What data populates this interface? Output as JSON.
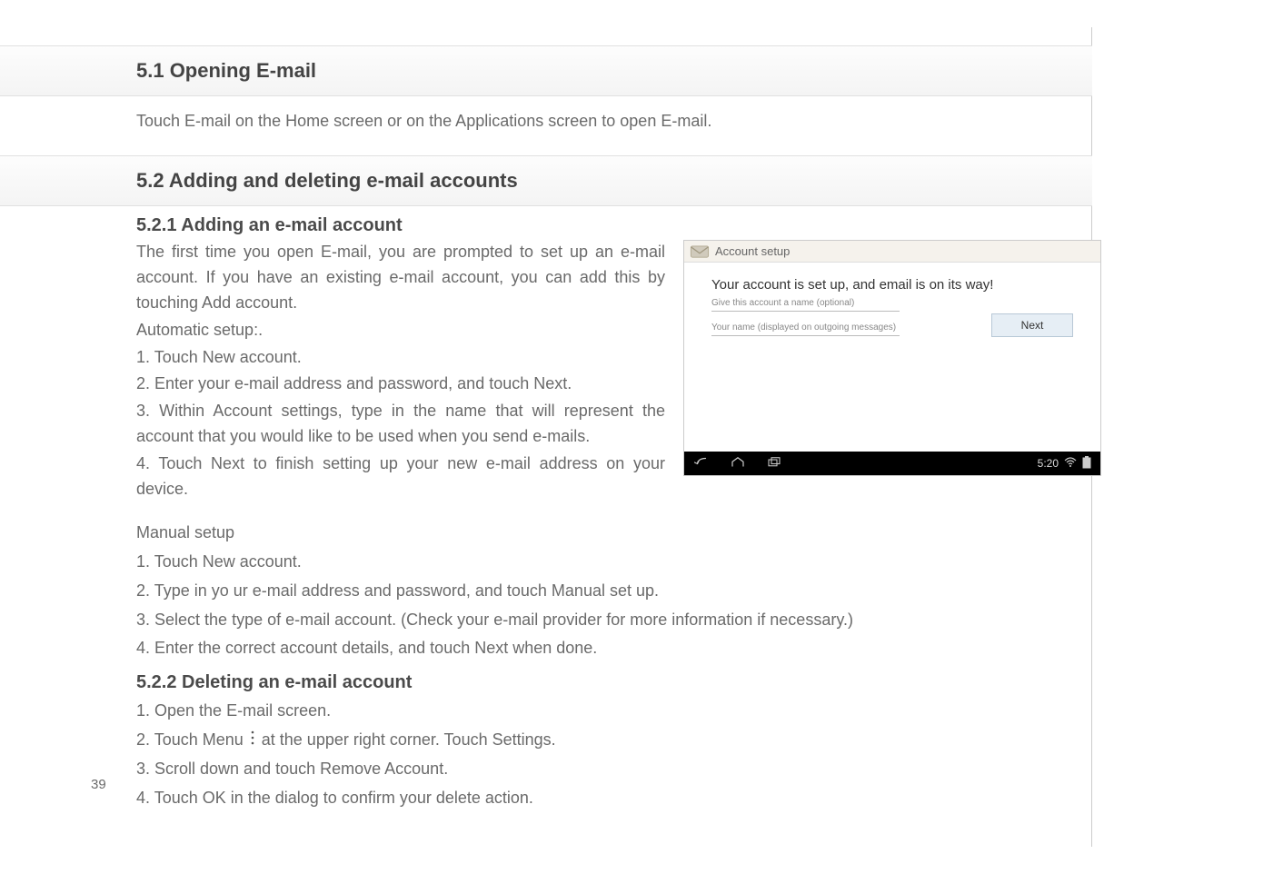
{
  "page_number": "39",
  "section1": {
    "heading": "5.1 Opening E-mail",
    "body": "Touch E-mail on the Home screen or on the Applications screen to open E-mail."
  },
  "section2": {
    "heading": "5.2 Adding and deleting e-mail accounts",
    "sub1": {
      "heading": "5.2.1 Adding an e-mail account",
      "intro": "The first time you open E-mail, you are prompted to set up an e-mail account. If you have an existing e-mail account, you can add this by touching Add account.",
      "auto_label": "Automatic setup:.",
      "auto_steps": {
        "s1": "1. Touch New account.",
        "s2": "2. Enter your e-mail address and password, and touch Next.",
        "s3": "3. Within Account settings, type in the name that will represent the account that you would like to be used when you send e-mails.",
        "s4": "4. Touch Next to finish setting up your new e-mail address on your device."
      },
      "manual_label": "Manual setup",
      "manual_steps": {
        "s1": "1. Touch New account.",
        "s2": "2. Type in yo ur e-mail address and password, and touch Manual set up.",
        "s3": "3. Select the type of e-mail account. (Check your e-mail provider for more information if necessary.)",
        "s4": "4. Enter the correct account details, and touch Next when done."
      }
    },
    "sub2": {
      "heading": "5.2.2 Deleting an e-mail account",
      "steps": {
        "s1": "1. Open the E-mail screen.",
        "s2a": "2. Touch Menu ",
        "s2b": " at the upper right corner. Touch Settings.",
        "s3": "3. Scroll down and touch Remove Account.",
        "s4": "4. Touch OK in the dialog to confirm your delete action."
      }
    }
  },
  "screenshot": {
    "app_title": "Account setup",
    "main_title": "Your account is set up, and email is on its way!",
    "field1_label": "Give this account a name (optional)",
    "field2_label": "Your name (displayed on outgoing messages)",
    "next_button": "Next",
    "clock": "5:20"
  }
}
